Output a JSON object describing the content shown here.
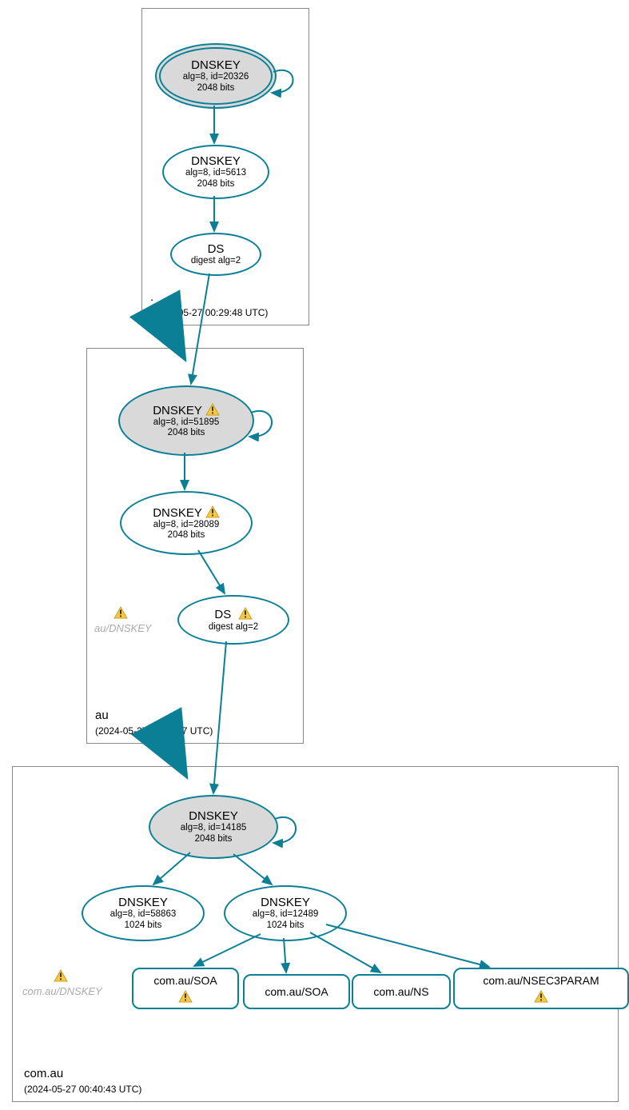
{
  "zones": {
    "root": {
      "name": ".",
      "timestamp": "(2024-05-27 00:29:48 UTC)"
    },
    "au": {
      "name": "au",
      "timestamp": "(2024-05-27 00:40:37 UTC)"
    },
    "comau": {
      "name": "com.au",
      "timestamp": "(2024-05-27 00:40:43 UTC)"
    }
  },
  "root": {
    "ksk": {
      "title": "DNSKEY",
      "alg": "alg=8, id=20326",
      "bits": "2048 bits"
    },
    "zsk": {
      "title": "DNSKEY",
      "alg": "alg=8, id=5613",
      "bits": "2048 bits"
    },
    "ds": {
      "title": "DS",
      "digest": "digest alg=2"
    }
  },
  "au": {
    "ksk": {
      "title": "DNSKEY",
      "alg": "alg=8, id=51895",
      "bits": "2048 bits"
    },
    "zsk": {
      "title": "DNSKEY",
      "alg": "alg=8, id=28089",
      "bits": "2048 bits"
    },
    "ds": {
      "title": "DS",
      "digest": "digest alg=2"
    },
    "note": "au/DNSKEY"
  },
  "comau": {
    "ksk": {
      "title": "DNSKEY",
      "alg": "alg=8, id=14185",
      "bits": "2048 bits"
    },
    "zsk1": {
      "title": "DNSKEY",
      "alg": "alg=8, id=58863",
      "bits": "1024 bits"
    },
    "zsk2": {
      "title": "DNSKEY",
      "alg": "alg=8, id=12489",
      "bits": "1024 bits"
    },
    "note": "com.au/DNSKEY",
    "rr1": "com.au/SOA",
    "rr2": "com.au/SOA",
    "rr3": "com.au/NS",
    "rr4": "com.au/NSEC3PARAM"
  }
}
